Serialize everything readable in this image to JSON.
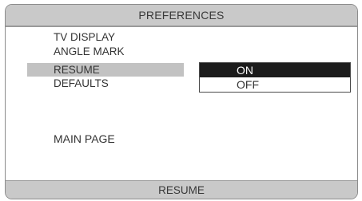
{
  "header": {
    "title": "PREFERENCES"
  },
  "menu": {
    "items": [
      {
        "label": "TV DISPLAY"
      },
      {
        "label": "ANGLE MARK"
      },
      {
        "label": "RESUME"
      },
      {
        "label": "DEFAULTS"
      }
    ],
    "highlighted_index": 2
  },
  "submenu": {
    "options": [
      {
        "label": "ON",
        "selected": true
      },
      {
        "label": "OFF",
        "selected": false
      }
    ]
  },
  "main_page_label": "MAIN PAGE",
  "status_bar": {
    "text": "RESUME"
  },
  "colors": {
    "bar_gray": "#c9c9c9",
    "highlight_gray": "#c2c2c2",
    "selected_black": "#1c1c1c"
  }
}
